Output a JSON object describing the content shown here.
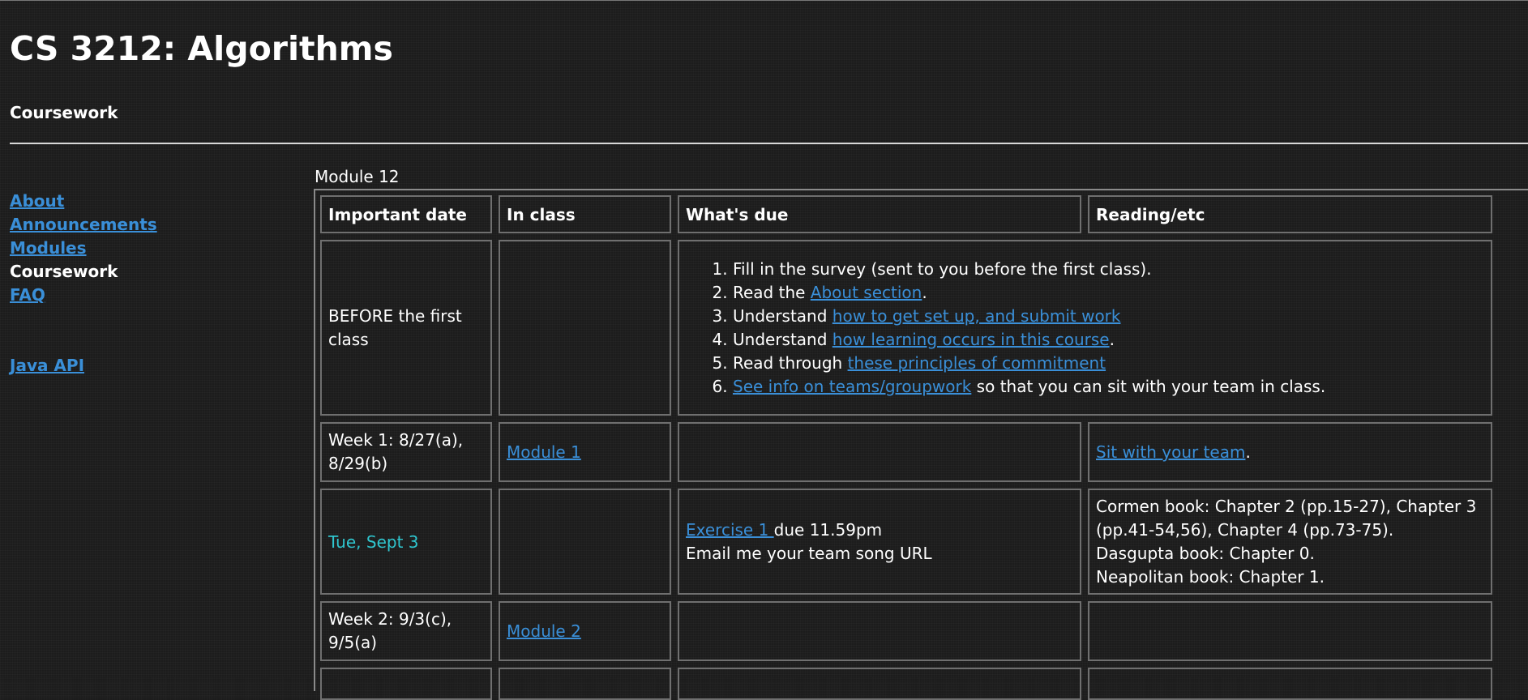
{
  "site": {
    "title": "CS 3212: Algorithms",
    "subtitle": "Coursework"
  },
  "sidebar": {
    "items": [
      {
        "label": "About",
        "link": true
      },
      {
        "label": "Announcements",
        "link": true
      },
      {
        "label": "Modules",
        "link": true
      },
      {
        "label": "Coursework",
        "link": false
      },
      {
        "label": "FAQ",
        "link": true
      }
    ],
    "extra": {
      "label": "Java API"
    }
  },
  "schedule": {
    "caption": "Module 12",
    "headers": [
      "Important date",
      "In class",
      "What's due",
      "Reading/etc"
    ],
    "row0": {
      "date": "BEFORE the first class",
      "todo": [
        {
          "text": "Fill in the survey (sent to you before the first class)."
        },
        {
          "pre": "Read the ",
          "link": "About section",
          "post": "."
        },
        {
          "pre": "Understand ",
          "link": "how to get set up, and submit work",
          "post": ""
        },
        {
          "pre": "Understand ",
          "link": "how learning occurs in this course",
          "post": "."
        },
        {
          "pre": "Read through ",
          "link": "these principles of commitment",
          "post": ""
        },
        {
          "link": "See info on teams/groupwork",
          "post": " so that you can sit with your team in class."
        }
      ]
    },
    "row1": {
      "date": "Week 1: 8/27(a), 8/29(b)",
      "inclass": "Module 1",
      "reading_link": "Sit with your team",
      "reading_post": "."
    },
    "row2": {
      "date": "Tue, Sept 3",
      "due_link": "Exercise 1 ",
      "due_post": "due 11.59pm",
      "due_line2": "Email me your team song URL",
      "reading": [
        "Cormen book: Chapter 2 (pp.15-27), Chapter 3 (pp.41-54,56), Chapter 4 (pp.73-75).",
        "Dasgupta book: Chapter 0.",
        "Neapolitan book: Chapter 1."
      ]
    },
    "row3": {
      "date": "Week 2: 9/3(c), 9/5(a)",
      "inclass": "Module 2"
    }
  },
  "colors": {
    "background": "#1c1c1c",
    "link": "#3a8fd8",
    "deadline": "#2fc6cf",
    "text": "#ffffff"
  }
}
